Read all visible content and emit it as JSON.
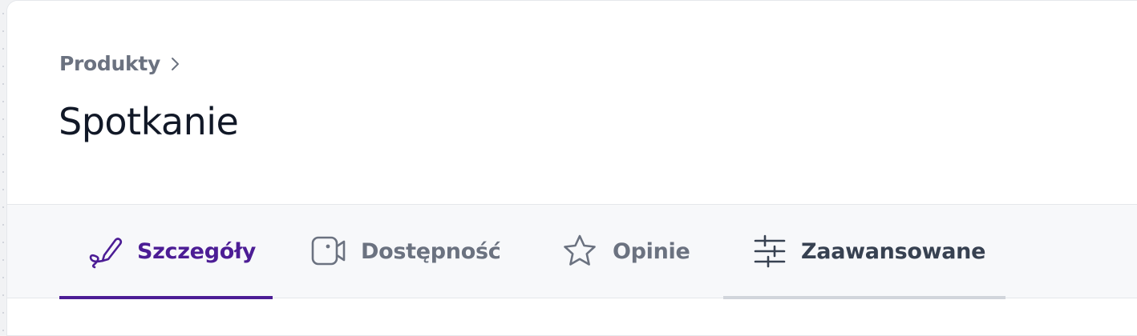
{
  "breadcrumb": {
    "parent": "Produkty"
  },
  "page": {
    "title": "Spotkanie"
  },
  "tabs": [
    {
      "id": "details",
      "label": "Szczegóły",
      "icon": "pencil-icon",
      "state": "active"
    },
    {
      "id": "availability",
      "label": "Dostępność",
      "icon": "video-icon",
      "state": "inactive"
    },
    {
      "id": "reviews",
      "label": "Opinie",
      "icon": "star-icon",
      "state": "inactive"
    },
    {
      "id": "advanced",
      "label": "Zaawansowane",
      "icon": "sliders-icon",
      "state": "hover"
    }
  ],
  "colors": {
    "accent": "#4c1d95",
    "muted_text": "#6b7280",
    "title_text": "#111827",
    "tabbar_bg": "#f7f8fa",
    "hover_underline": "#d1d5db"
  }
}
